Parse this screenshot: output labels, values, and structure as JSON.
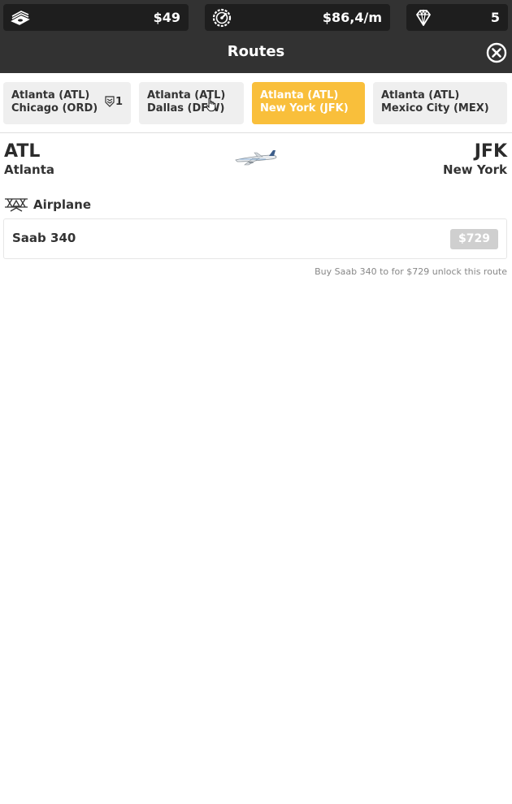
{
  "stats": {
    "cash": {
      "icon": "cash-stack-icon",
      "value": "$49"
    },
    "income": {
      "icon": "speedometer-icon",
      "value": "$86,4/m"
    },
    "gems": {
      "icon": "diamond-icon",
      "value": "5"
    }
  },
  "header": {
    "title": "Routes",
    "close_icon": "close-circle-icon"
  },
  "tabs": [
    {
      "from": "Atlanta (ATL)",
      "to": "Chicago (ORD)",
      "badge": "1",
      "badge_icon": "shield-badge-icon",
      "active": false
    },
    {
      "from": "Atlanta (ATL)",
      "to": "Dallas (DFW)",
      "active": false
    },
    {
      "from": "Atlanta (ATL)",
      "to": "New York (JFK)",
      "active": true
    },
    {
      "from": "Atlanta (ATL)",
      "to": "Mexico City (MEX)",
      "active": false
    }
  ],
  "route": {
    "origin": {
      "code": "ATL",
      "city": "Atlanta"
    },
    "destination": {
      "code": "JFK",
      "city": "New York"
    },
    "image": "airliner-icon"
  },
  "airplane_section": {
    "icon": "biplane-icon",
    "label": "Airplane",
    "plane_name": "Saab 340",
    "price": "$729",
    "hint": "Buy Saab 340 to for $729 unlock this route"
  },
  "colors": {
    "topbar": "#323232",
    "stat_bg": "#1e1e1e",
    "active_tab": "#f9bf3b",
    "tab_bg": "#efefef",
    "buy_button_disabled": "#cfcfcf"
  }
}
